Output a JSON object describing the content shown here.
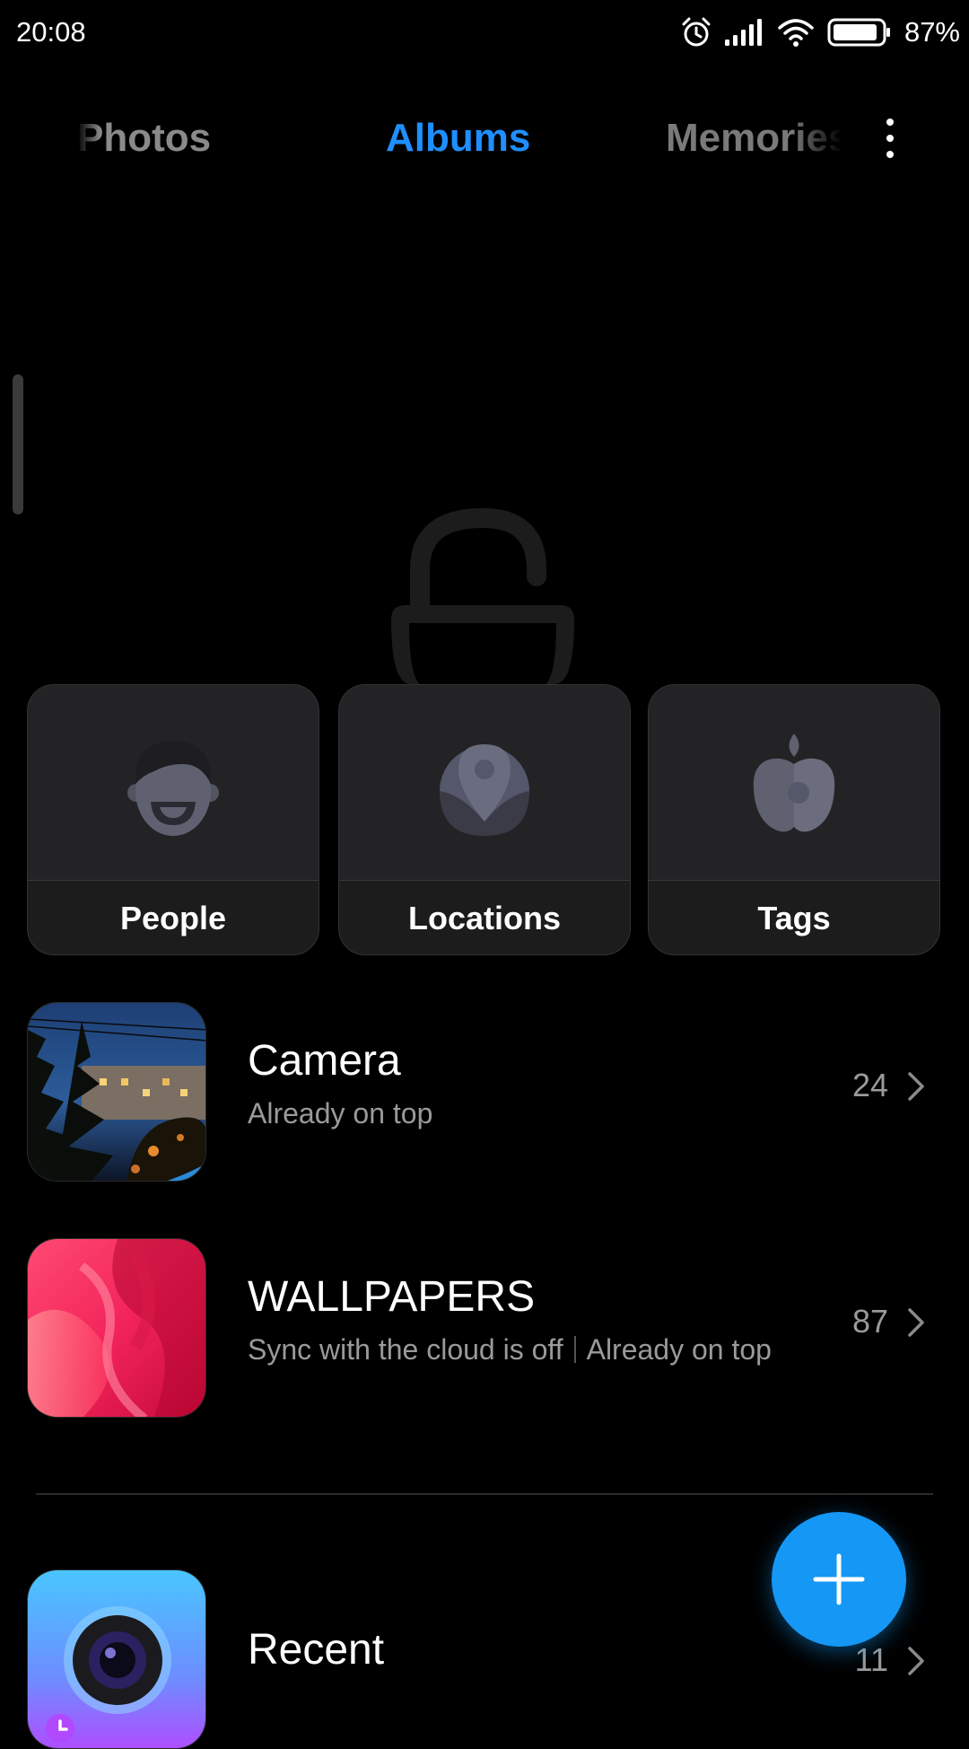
{
  "status_bar": {
    "time": "20:08",
    "battery_percent": "87%",
    "icons": [
      "alarm-icon",
      "signal-icon",
      "wifi-icon",
      "battery-icon"
    ]
  },
  "tabs": {
    "photos": "Photos",
    "albums": "Albums",
    "memories": "Memories",
    "active": "albums",
    "active_color": "#1f8fff"
  },
  "categories": [
    {
      "label": "People",
      "icon": "person-face-icon"
    },
    {
      "label": "Locations",
      "icon": "location-pin-icon"
    },
    {
      "label": "Tags",
      "icon": "tag-apple-icon"
    }
  ],
  "albums": [
    {
      "name": "Camera",
      "subtitle": "Already on top",
      "count": "24"
    },
    {
      "name": "WALLPAPERS",
      "subtitle_parts": [
        "Sync with the cloud is off",
        "Already on top"
      ],
      "count": "87"
    },
    {
      "name": "Recent",
      "count": "11"
    }
  ],
  "fab": {
    "icon": "plus-icon",
    "color": "#1597f5"
  }
}
